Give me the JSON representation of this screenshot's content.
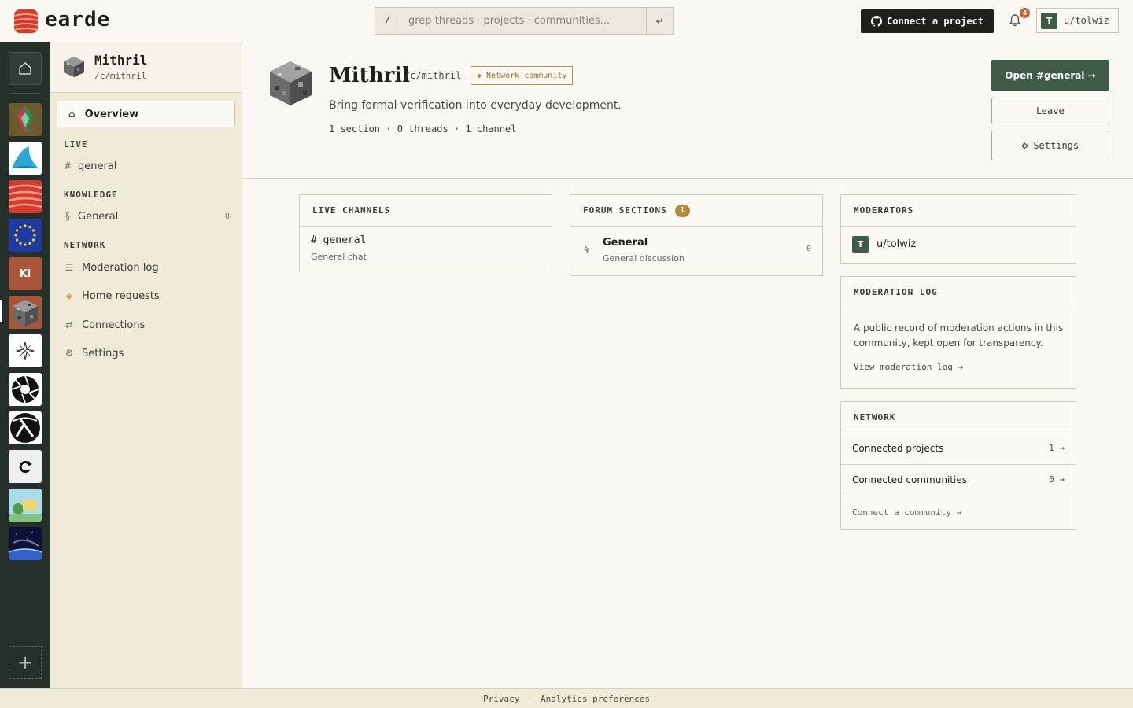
{
  "app": {
    "name": "earde",
    "search_placeholder": "grep threads · projects · communities...",
    "search_prefix": "/",
    "search_submit": "↵",
    "connect_label": "Connect a project",
    "notif_count": "4",
    "user_initial": "T",
    "user_name": "u/tolwiz"
  },
  "rail": {
    "items": [
      {
        "name": "home",
        "icon": "home-icon"
      },
      {
        "name": "crystal-community",
        "icon": "crystal-icon"
      },
      {
        "name": "shark-fin-community",
        "icon": "fin-icon"
      },
      {
        "name": "earde-community",
        "icon": "earde-logo-icon"
      },
      {
        "name": "eu-community",
        "icon": "eu-flag-icon"
      },
      {
        "name": "kl-community",
        "label": "Kl"
      },
      {
        "name": "mithril-community",
        "icon": "ore-block-icon"
      },
      {
        "name": "compass-community",
        "icon": "compass-star-icon"
      },
      {
        "name": "aperture-community",
        "icon": "aperture-icon"
      },
      {
        "name": "lambda-community",
        "icon": "lambda-icon"
      },
      {
        "name": "arrow-community",
        "icon": "refresh-arrow-icon"
      },
      {
        "name": "good-day-community",
        "icon": "good-day-image-icon"
      },
      {
        "name": "space-community",
        "icon": "planet-icon"
      }
    ],
    "add_label": "+"
  },
  "sidebar": {
    "name": "Mithril",
    "path": "/c/mithril",
    "overview": "Overview",
    "live_label": "LIVE",
    "live_items": [
      {
        "icon": "#",
        "label": "general"
      }
    ],
    "knowledge_label": "KNOWLEDGE",
    "knowledge_items": [
      {
        "icon": "§",
        "label": "General",
        "count": "0"
      }
    ],
    "network_label": "NETWORK",
    "network_items": [
      {
        "icon": "☰",
        "label": "Moderation log"
      },
      {
        "icon": "◈",
        "label": "Home requests"
      },
      {
        "icon": "⇄",
        "label": "Connections"
      },
      {
        "icon": "⚙",
        "label": "Settings"
      }
    ]
  },
  "hero": {
    "title": "Mithril",
    "path": "/c/mithril",
    "badge": "◈ Network community",
    "description": "Bring formal verification into everyday development.",
    "stats": "1 section · 0 threads · 1 channel",
    "open_label": "Open #general →",
    "leave_label": "Leave",
    "settings_label": "⚙ Settings"
  },
  "live_channels": {
    "heading": "LIVE CHANNELS",
    "items": [
      {
        "name": "# general",
        "desc": "General chat"
      }
    ]
  },
  "forum_sections": {
    "heading": "FORUM SECTIONS",
    "count": "1",
    "items": [
      {
        "icon": "§",
        "name": "General",
        "desc": "General discussion",
        "count": "0"
      }
    ]
  },
  "moderators": {
    "heading": "MODERATORS",
    "items": [
      {
        "initial": "T",
        "name": "u/tolwiz"
      }
    ]
  },
  "moderation_log": {
    "heading": "MODERATION LOG",
    "text": "A public record of moderation actions in this community, kept open for transparency.",
    "link": "View moderation log →"
  },
  "network": {
    "heading": "NETWORK",
    "rows": [
      {
        "label": "Connected projects",
        "value": "1 →"
      },
      {
        "label": "Connected communities",
        "value": "0 →"
      }
    ],
    "link": "Connect a community →"
  },
  "footer": {
    "privacy": "Privacy",
    "sep": "·",
    "analytics": "Analytics preferences"
  },
  "colors": {
    "accent": "#3f5a47",
    "rail": "#25302a",
    "badge": "#b58a3e"
  }
}
